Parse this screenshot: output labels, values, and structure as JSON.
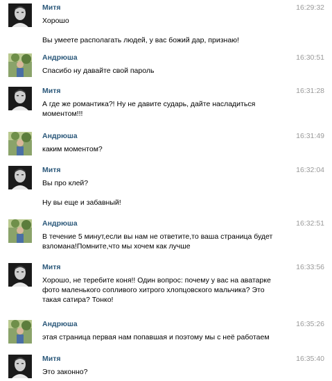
{
  "colors": {
    "author_link": "#2b587a",
    "timestamp": "#999999",
    "text": "#000000",
    "background": "#ffffff"
  },
  "messages": [
    {
      "author": "Митя",
      "time": "16:29:32",
      "avatar": "mitya-avatar",
      "lines": [
        "Хорошо",
        "Вы умеете располагать людей, у вас божий дар, признаю!"
      ]
    },
    {
      "author": "Андрюша",
      "time": "16:30:51",
      "avatar": "andryusha-avatar",
      "lines": [
        "Спасибо ну давайте свой пароль"
      ]
    },
    {
      "author": "Митя",
      "time": "16:31:28",
      "avatar": "mitya-avatar",
      "lines": [
        "А где же романтика?! Ну не давите сударь, дайте насладиться моментом!!!"
      ]
    },
    {
      "author": "Андрюша",
      "time": "16:31:49",
      "avatar": "andryusha-avatar",
      "lines": [
        "каким моментом?"
      ]
    },
    {
      "author": "Митя",
      "time": "16:32:04",
      "avatar": "mitya-avatar",
      "lines": [
        "Вы про клей?",
        "Ну вы еще и забавный!"
      ]
    },
    {
      "author": "Андрюша",
      "time": "16:32:51",
      "avatar": "andryusha-avatar",
      "lines": [
        "В течение 5 минут,если вы нам не ответите,то ваша страница будет взломана!Помните,что мы хочем как лучше"
      ]
    },
    {
      "author": "Митя",
      "time": "16:33:56",
      "avatar": "mitya-avatar",
      "lines": [
        "Хорошо, не теребите коня!! Один вопрос: почему у вас на аватарке фото маленького сопливого хитрого хлопцовского мальчика? Это такая сатира? Тонко!"
      ]
    },
    {
      "author": "Андрюша",
      "time": "16:35:26",
      "avatar": "andryusha-avatar",
      "lines": [
        "этая страница первая нам попавшая и поэтому мы с неё работаем"
      ]
    },
    {
      "author": "Митя",
      "time": "16:35:40",
      "avatar": "mitya-avatar",
      "lines": [
        "Это законно?"
      ]
    }
  ]
}
